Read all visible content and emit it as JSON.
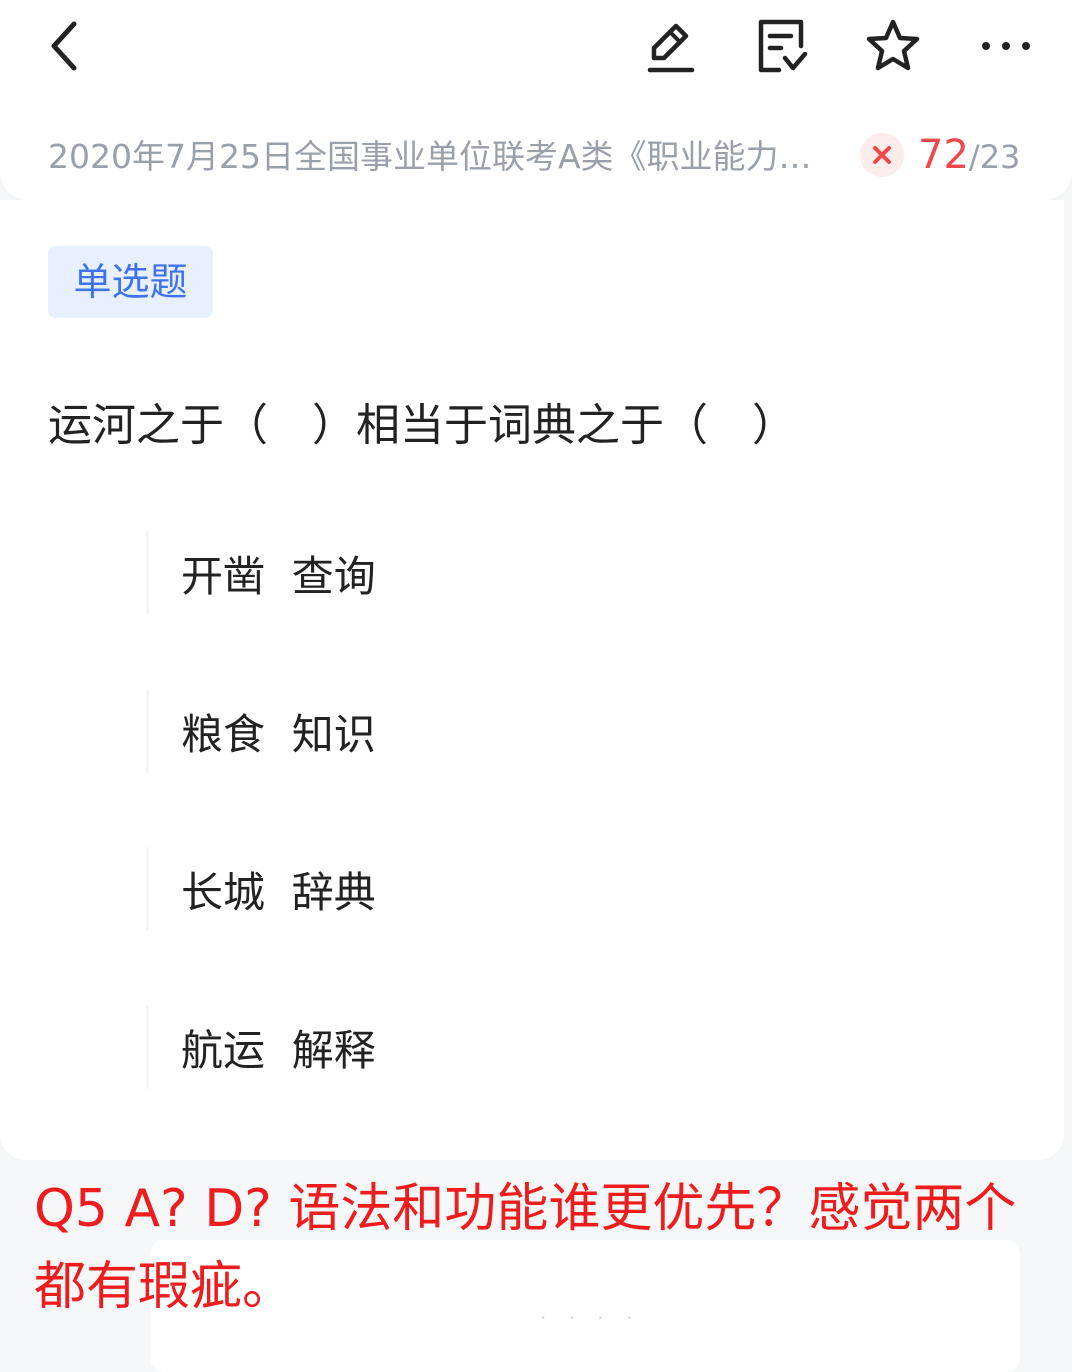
{
  "header": {
    "icons": [
      "chevron-left-icon",
      "edit-icon",
      "note-check-icon",
      "star-icon",
      "more-icon"
    ],
    "breadcrumb": "2020年7月25日全国事业单位联考A类《职业能力…",
    "status_icon": "close-icon",
    "counter": {
      "current": "72",
      "separator": "/",
      "total": "23"
    },
    "colors": {
      "accent_red": "#f04848",
      "muted": "#9aa0aa",
      "badge_bg": "#fdecec"
    }
  },
  "question": {
    "type_label": "单选题",
    "stem": "运河之于（　）相当于词典之于（　）",
    "options": [
      "开凿  查询",
      "粮食  知识",
      "长城  辞典",
      "航运  解释"
    ],
    "colors": {
      "tag_bg": "#e8f0ff",
      "tag_text": "#3f73ee"
    }
  },
  "annotation": {
    "text": "Q5 A? D? 语法和功能谁更优先？感觉两个都有瑕疵。",
    "color": "#ee1c1c"
  }
}
